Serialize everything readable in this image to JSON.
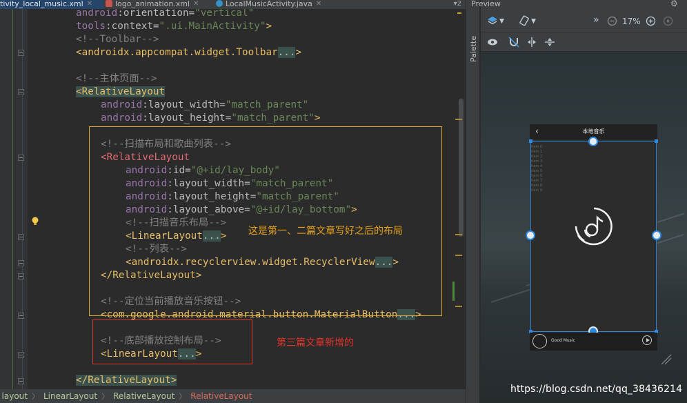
{
  "tabs": {
    "tab1": "tivity_local_music.xml",
    "tab2": "logo_animation.xml",
    "tab3": "LocalMusicActivity.java",
    "more": "▾2"
  },
  "code": {
    "l1_ns": "android",
    "l1_attr": ":orientation=",
    "l1_val": "\"vertical\"",
    "l2_ns": "tools",
    "l2_attr": ":context=",
    "l2_val": "\".ui.MainActivity\"",
    "l2_end": ">",
    "l3": "<!--Toolbar-->",
    "l4_tag": "<androidx.appcompat.widget.Toolbar",
    "l4_dots": "...",
    "l4_end": ">",
    "l6": "<!--主体页面-->",
    "l7_tag": "<RelativeLayout",
    "l8_ns": "android",
    "l8_attr": ":layout_width=",
    "l8_val": "\"match_parent\"",
    "l9_ns": "android",
    "l9_attr": ":layout_height=",
    "l9_val": "\"match_parent\"",
    "l9_end": ">",
    "l11": "<!--扫描布局和歌曲列表-->",
    "l12_tag": "<RelativeLayout",
    "l13_ns": "android",
    "l13_attr": ":id=",
    "l13_val": "\"@+id/lay_body\"",
    "l14_ns": "android",
    "l14_attr": ":layout_width=",
    "l14_val": "\"match_parent\"",
    "l15_ns": "android",
    "l15_attr": ":layout_height=",
    "l15_val": "\"match_parent\"",
    "l16_ns": "android",
    "l16_attr": ":layout_above=",
    "l16_val": "\"@+id/lay_bottom\"",
    "l16_end": ">",
    "l17": "<!--扫描音乐布局-->",
    "l18_tag": "<LinearLayout",
    "l18_dots": "...",
    "l18_end": ">",
    "l19": "<!--列表-->",
    "l20_tag": "<androidx.recyclerview.widget.RecyclerView",
    "l20_dots": "...",
    "l20_end": ">",
    "l21": "</RelativeLayout>",
    "l23": "<!--定位当前播放音乐按钮-->",
    "l24_tag": "<com.google.android.material.button.MaterialButton",
    "l24_dots": "...",
    "l24_end": ">",
    "l25": "<!--底部播放控制布局-->",
    "l26_tag": "<LinearLayout",
    "l26_dots": "...",
    "l26_end": ">",
    "l28": "</RelativeLayout>"
  },
  "annotations": {
    "yellow": "这是第一、二篇文章写好之后的布局",
    "red": "第三篇文章新增的"
  },
  "breadcrumb": {
    "c1": "layout",
    "c2": "LinearLayout",
    "c3": "RelativeLayout",
    "c4": "RelativeLayout",
    "sep": "〉"
  },
  "palette": {
    "label": "Palette"
  },
  "preview": {
    "title": "Preview",
    "zoom": "17%",
    "more": "»",
    "phone_title": "本地音乐",
    "back": "‹",
    "items": [
      "Item 0",
      "Item 1",
      "Item 2",
      "Item 3",
      "Item 4",
      "Item 5",
      "Item 6",
      "Item 7",
      "Item 8",
      "Item 9"
    ],
    "song": "Good Music"
  },
  "watermark": "https://blog.csdn.net/qq_38436214",
  "colors": {
    "annotation_yellow": "#d9a72a",
    "annotation_red": "#d83a2e",
    "selection_blue": "#2d8ae2"
  }
}
